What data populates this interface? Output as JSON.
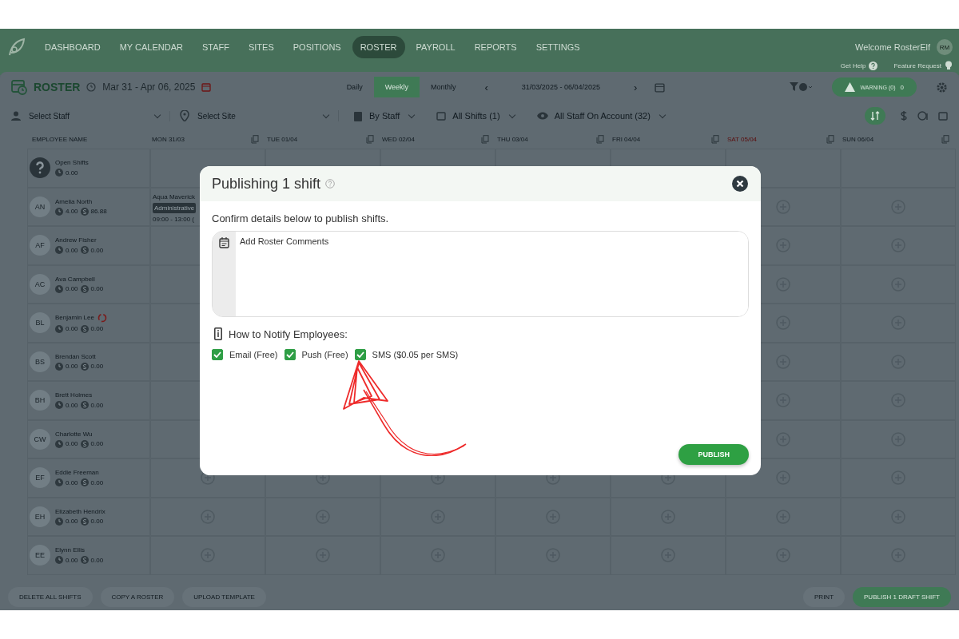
{
  "nav": {
    "items": [
      {
        "label": "DASHBOARD",
        "selected": false
      },
      {
        "label": "MY CALENDAR",
        "selected": false
      },
      {
        "label": "STAFF",
        "selected": false
      },
      {
        "label": "SITES",
        "selected": false
      },
      {
        "label": "POSITIONS",
        "selected": false
      },
      {
        "label": "ROSTER",
        "selected": true
      },
      {
        "label": "PAYROLL",
        "selected": false
      },
      {
        "label": "REPORTS",
        "selected": false
      },
      {
        "label": "SETTINGS",
        "selected": false
      }
    ],
    "welcome": "Welcome RosterElf",
    "avatar": "RM",
    "help": "Get Help",
    "feature": "Feature Request"
  },
  "header": {
    "title": "ROSTER",
    "range": "Mar 31 - Apr 06, 2025",
    "views": [
      {
        "label": "Daily",
        "selected": false
      },
      {
        "label": "Weekly",
        "selected": true
      },
      {
        "label": "Monthly",
        "selected": false
      }
    ],
    "prev": "‹",
    "dates": "31/03/2025 - 06/04/2025",
    "next": "›",
    "warning": "WARNING (0)",
    "warning_count": "0"
  },
  "filters": {
    "staff": {
      "placeholder": "Select Staff"
    },
    "site": {
      "placeholder": "Select Site"
    },
    "group": "By Staff",
    "shifts": "All Shifts (1)",
    "account": "All Staff On Account (32)"
  },
  "table": {
    "name_column": "EMPLOYEE NAME",
    "days": [
      {
        "label": "MON 31/03",
        "highlighted": false
      },
      {
        "label": "TUE 01/04",
        "highlighted": false
      },
      {
        "label": "WED 02/04",
        "highlighted": false
      },
      {
        "label": "THU 03/04",
        "highlighted": false
      },
      {
        "label": "FRI 04/04",
        "highlighted": false
      },
      {
        "label": "SAT 05/04",
        "highlighted": true
      },
      {
        "label": "SUN 06/04",
        "highlighted": false
      }
    ],
    "rows": [
      {
        "kind": "open",
        "name": "Open Shifts",
        "hours": "0.00"
      },
      {
        "kind": "staff",
        "initials": "AN",
        "name": "Amelia North",
        "hours": "4.00",
        "cost": "86.88",
        "shift": {
          "site": "Aqua Maverick",
          "position": "Administrative",
          "time": "09:00 - 13:00 ("
        }
      },
      {
        "kind": "staff",
        "initials": "AF",
        "name": "Andrew Fisher",
        "hours": "0.00",
        "cost": "0.00"
      },
      {
        "kind": "staff",
        "initials": "AC",
        "name": "Ava Campbell",
        "hours": "0.00",
        "cost": "0.00"
      },
      {
        "kind": "staff",
        "initials": "BL",
        "name": "Benjamin Lee",
        "hours": "0.00",
        "cost": "0.00",
        "sync_flag": true
      },
      {
        "kind": "staff",
        "initials": "BS",
        "name": "Brendan Scott",
        "hours": "0.00",
        "cost": "0.00"
      },
      {
        "kind": "staff",
        "initials": "BH",
        "name": "Brett Holmes",
        "hours": "0.00",
        "cost": "0.00"
      },
      {
        "kind": "staff",
        "initials": "CW",
        "name": "Charlotte Wu",
        "hours": "0.00",
        "cost": "0.00"
      },
      {
        "kind": "staff",
        "initials": "EF",
        "name": "Eddie Freeman",
        "hours": "0.00",
        "cost": "0.00"
      },
      {
        "kind": "staff",
        "initials": "EH",
        "name": "Elizabeth Hendrix",
        "hours": "0.00",
        "cost": "0.00"
      },
      {
        "kind": "staff",
        "initials": "EE",
        "name": "Elynn Ellis",
        "hours": "0.00",
        "cost": "0.00"
      }
    ]
  },
  "footer": {
    "left": [
      "DELETE ALL SHIFTS",
      "COPY A ROSTER",
      "UPLOAD TEMPLATE"
    ],
    "print": "PRINT",
    "publish": "PUBLISH 1 DRAFT SHIFT"
  },
  "modal": {
    "title": "Publishing 1 shift",
    "intro": "Confirm details below to publish shifts.",
    "comments": {
      "placeholder": "Add Roster Comments"
    },
    "notify_heading": "How to Notify Employees:",
    "options": [
      {
        "label": "Email (Free)",
        "checked": true
      },
      {
        "label": "Push (Free)",
        "checked": true
      },
      {
        "label": "SMS ($0.05 per SMS)",
        "checked": true
      }
    ],
    "publish": "PUBLISH"
  }
}
